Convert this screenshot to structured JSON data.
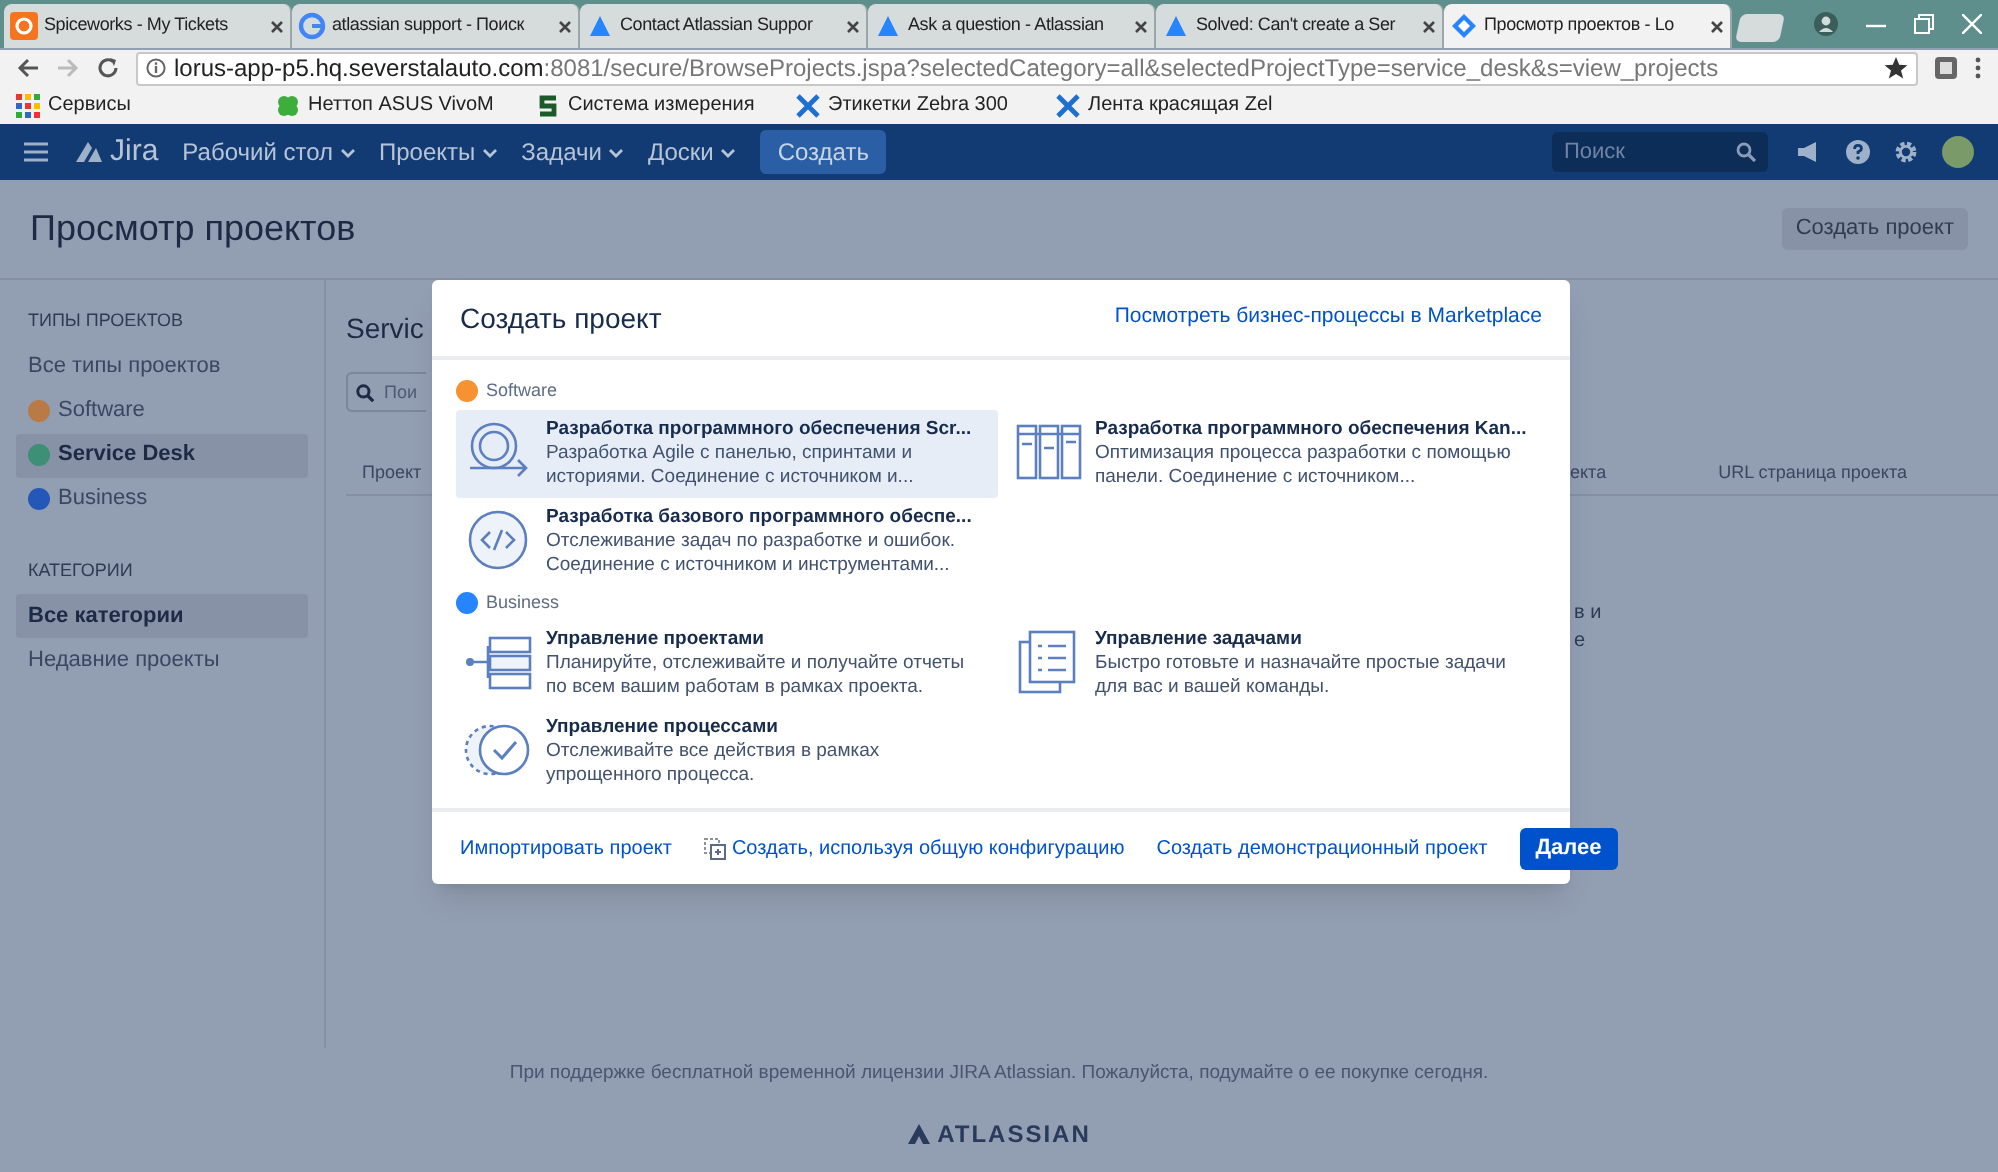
{
  "browser": {
    "tabs": [
      {
        "title": "Spiceworks - My Tickets",
        "selected": false
      },
      {
        "title": "atlassian support - Поиск",
        "selected": false
      },
      {
        "title": "Contact Atlassian Suppor",
        "selected": false
      },
      {
        "title": "Ask a question - Atlassian",
        "selected": false
      },
      {
        "title": "Solved: Can't create a Ser",
        "selected": false
      },
      {
        "title": "Просмотр проектов - Lo",
        "selected": true
      }
    ],
    "address_host": "lorus-app-p5.hq.severstalauto.com",
    "address_path": ":8081/secure/BrowseProjects.jspa?selectedCategory=all&selectedProjectType=service_desk&s=view_projects",
    "bookmarks": [
      "Сервисы",
      "Неттоп ASUS VivoM",
      "Система измерения",
      "Этикетки Zebra 300",
      "Лента красящая Zel"
    ]
  },
  "jira": {
    "logo": "Jira",
    "menus": [
      "Рабочий стол",
      "Проекты",
      "Задачи",
      "Доски"
    ],
    "create": "Создать",
    "search_placeholder": "Поиск"
  },
  "page": {
    "title": "Просмотр проектов",
    "create_project": "Создать проект",
    "sidebar": [
      {
        "heading": "ТИПЫ ПРОЕКТОВ",
        "items": [
          {
            "label": "Все типы проектов",
            "selected": false
          },
          {
            "label": "Software",
            "color": "#b97a45",
            "selected": false
          },
          {
            "label": "Service Desk",
            "color": "#3d8f76",
            "selected": true
          },
          {
            "label": "Business",
            "color": "#2357b8",
            "selected": false
          }
        ]
      },
      {
        "heading": "КАТЕГОРИИ",
        "items": [
          {
            "label": "Все категории",
            "selected": true
          },
          {
            "label": "Недавние проекты",
            "selected": false
          }
        ]
      }
    ],
    "main_heading": "Servic",
    "search_placeholder": "Пои",
    "column_left": "Проект",
    "columns_right": [
      "екта",
      "URL страница проекта"
    ],
    "row_fragments": [
      "в и",
      "е"
    ]
  },
  "modal": {
    "title": "Создать проект",
    "marketplace_link": "Посмотреть бизнес-процессы в Marketplace",
    "groups": [
      {
        "label": "Software",
        "color": "#f79232",
        "items": [
          {
            "kind": "scrum",
            "title": "Разработка программного обеспечения Scr...",
            "description": "Разработка Agile с панелью, спринтами и историями. Соединение с источником и...",
            "selected": true
          },
          {
            "kind": "kanban",
            "title": "Разработка программного обеспечения Kan...",
            "description": "Оптимизация процесса разработки с помощью панели. Соединение с источником...",
            "selected": false
          },
          {
            "kind": "basic",
            "title": "Разработка базового программного обеспе...",
            "description": "Отслеживание задач по разработке и ошибок. Соединение с источником и инструментами...",
            "selected": false
          }
        ]
      },
      {
        "label": "Business",
        "color": "#2684ff",
        "items": [
          {
            "kind": "project",
            "title": "Управление проектами",
            "description": "Планируйте, отслеживайте и получайте отчеты по всем вашим работам в рамках проекта.",
            "selected": false
          },
          {
            "kind": "task",
            "title": "Управление задачами",
            "description": "Быстро готовьте и назначайте простые задачи для вас и вашей команды.",
            "selected": false
          },
          {
            "kind": "process",
            "title": "Управление процессами",
            "description": "Отслеживайте все действия в рамках упрощенного процесса.",
            "selected": false
          }
        ]
      }
    ],
    "footer_links": [
      {
        "label": "Импортировать проект",
        "kind": "plain"
      },
      {
        "label": "Создать, используя общую конфигурацию",
        "kind": "icon"
      },
      {
        "label": "Создать демонстрационный проект",
        "kind": "plain"
      }
    ],
    "next_button": "Далее"
  },
  "footer": {
    "license": "При поддержке бесплатной временной лицензии JIRA Atlassian. Пожалуйста, подумайте о ее покупке сегодня.",
    "logo": "ATLASSIAN"
  }
}
